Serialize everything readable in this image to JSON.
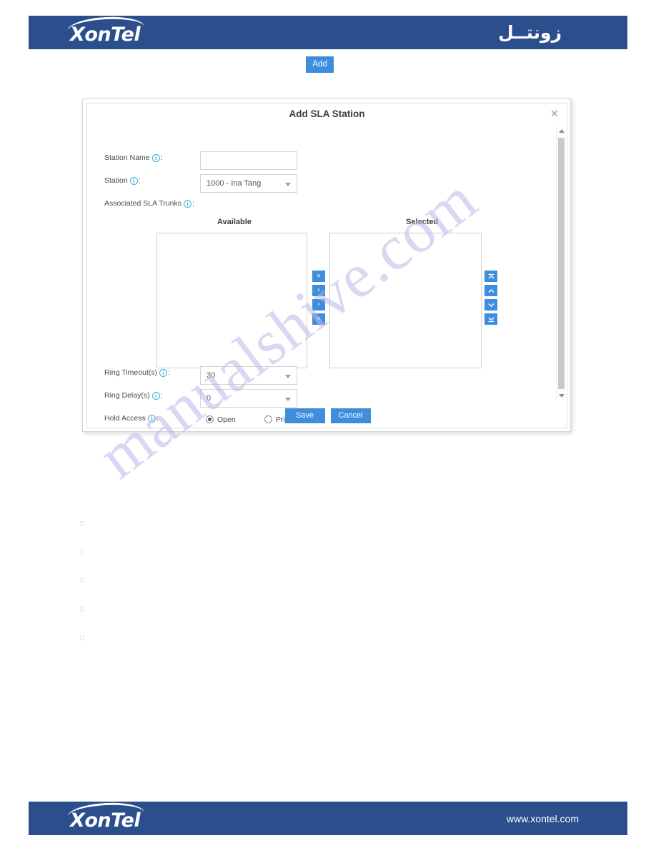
{
  "header": {
    "logo_text": "XonTel",
    "brand_arabic": "زونتــل",
    "bar_color": "#2B4E8C"
  },
  "footer": {
    "logo_text": "XonTel",
    "url": "www.xontel.com"
  },
  "toolbar": {
    "add_label": "Add",
    "accent_color": "#3E8EDE"
  },
  "watermark": {
    "text": "manualshive.com"
  },
  "dialog": {
    "title": "Add SLA Station",
    "close_icon": "✕",
    "fields": {
      "station_name": {
        "label": "Station Name",
        "info_icon": "i",
        "colon": ":",
        "value": "",
        "placeholder": ""
      },
      "station": {
        "label": "Station",
        "info_icon": "i",
        "colon": ":",
        "value": "1000 - Ina Tang"
      },
      "associated_trunks": {
        "label": "Associated SLA Trunks",
        "info_icon": "i",
        "colon": ":"
      },
      "ring_timeout": {
        "label": "Ring Timeout(s)",
        "info_icon": "i",
        "colon": ":",
        "value": "30"
      },
      "ring_delay": {
        "label": "Ring Delay(s)",
        "info_icon": "i",
        "colon": ":",
        "value": "0"
      },
      "hold_access": {
        "label": "Hold Access",
        "info_icon": "i",
        "colon": ":",
        "options": [
          {
            "label": "Open",
            "selected": true
          },
          {
            "label": "Private",
            "selected": false
          }
        ]
      }
    },
    "dual_list": {
      "available_caption": "Available",
      "selected_caption": "Selected",
      "available_items": [],
      "selected_items": [],
      "transfer_buttons": [
        {
          "name": "move-all-right",
          "glyph": "»"
        },
        {
          "name": "move-right",
          "glyph": "›"
        },
        {
          "name": "move-left",
          "glyph": "‹"
        },
        {
          "name": "move-all-left",
          "glyph": "«"
        }
      ],
      "order_buttons": [
        {
          "name": "move-top",
          "glyph": "⤒"
        },
        {
          "name": "move-up",
          "glyph": "∧"
        },
        {
          "name": "move-down",
          "glyph": "∨"
        },
        {
          "name": "move-bottom",
          "glyph": "⤓"
        }
      ]
    },
    "buttons": {
      "save_label": "Save",
      "cancel_label": "Cancel"
    },
    "scrollbar": {
      "up_arrow": "▲",
      "down_arrow": "▼"
    }
  }
}
